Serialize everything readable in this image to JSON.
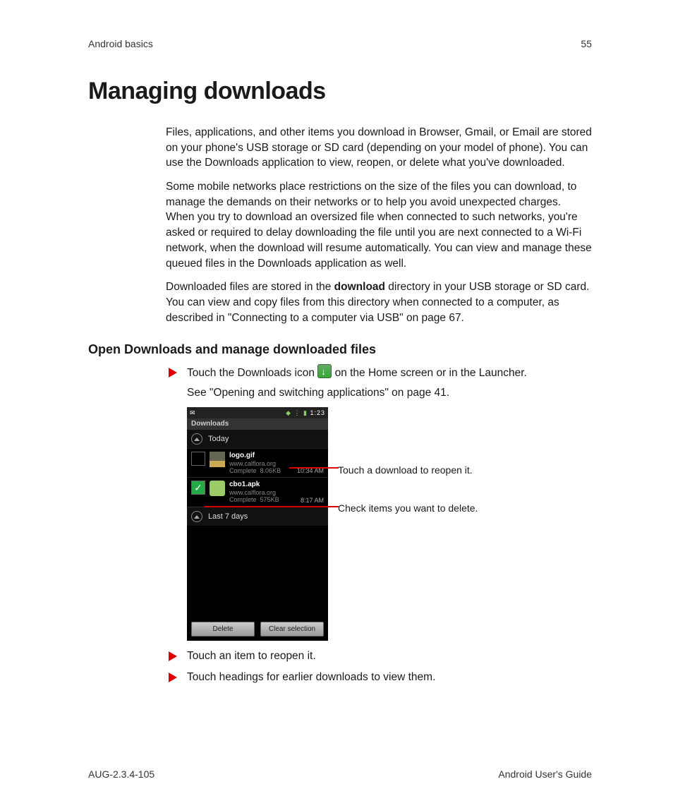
{
  "header": {
    "section": "Android basics",
    "page": "55"
  },
  "title": "Managing downloads",
  "p1": "Files, applications, and other items you download in Browser, Gmail, or Email are stored on your phone's USB storage or SD card (depending on your model of phone). You can use the Downloads application to view, reopen, or delete what you've downloaded.",
  "p2": "Some mobile networks place restrictions on the size of the files you can download, to manage the demands on their networks or to help you avoid unexpected charges. When you try to download an oversized file when connected to such networks, you're asked or required to delay downloading the file until you are next connected to a Wi-Fi network, when the download will resume automatically. You can view and manage these queued files in the Downloads application as well.",
  "p3a": "Downloaded files are stored in the ",
  "p3b": "download",
  "p3c": " directory in your USB storage or SD card. You can view and copy files from this directory when connected to a computer, as described in \"Connecting to a computer via USB\" on page 67.",
  "h2": "Open Downloads and manage downloaded files",
  "step1a": "Touch the Downloads icon ",
  "step1b": " on the Home screen or in the Launcher.",
  "step1_sub": "See \"Opening and switching applications\" on page 41.",
  "step2": "Touch an item to reopen it.",
  "step3": "Touch headings for earlier downloads to view them.",
  "phone": {
    "clock": "1:23",
    "title": "Downloads",
    "section1": "Today",
    "items": [
      {
        "name": "logo.gif",
        "url": "www.calflora.org",
        "status": "Complete",
        "size": "8.06KB",
        "time": "10:34 AM",
        "checked": false,
        "thumb": "img"
      },
      {
        "name": "cbo1.apk",
        "url": "www.calflora.org",
        "status": "Complete",
        "size": "575KB",
        "time": "8:17 AM",
        "checked": true,
        "thumb": "apk"
      }
    ],
    "section2": "Last 7 days",
    "btn1": "Delete",
    "btn2": "Clear selection"
  },
  "callout1": "Touch a download to reopen it.",
  "callout2": "Check items you want to delete.",
  "footer": {
    "left": "AUG-2.3.4-105",
    "right": "Android User's Guide"
  }
}
